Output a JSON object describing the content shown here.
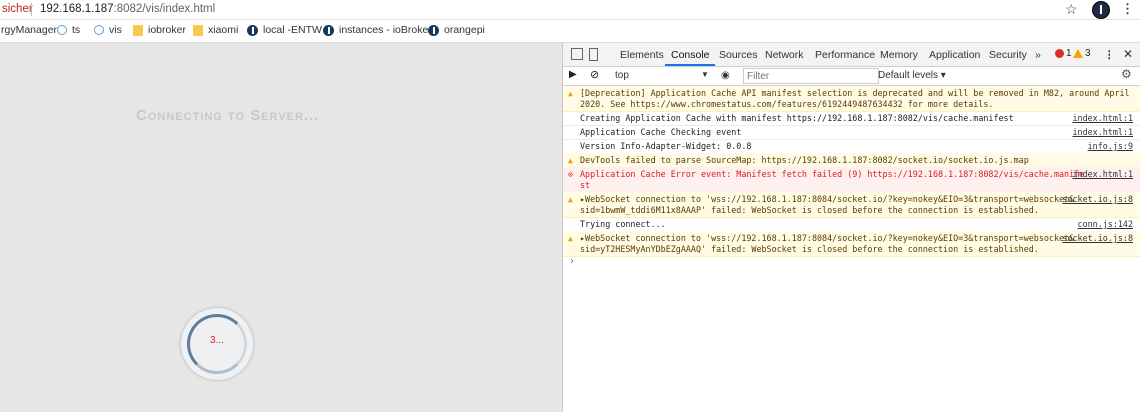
{
  "address_bar": {
    "security_text": "sicher",
    "url_host": "192.168.1.187",
    "url_rest": ":8082/vis/index.html"
  },
  "bookmarks": [
    {
      "label": "rgyManager",
      "icon": "none"
    },
    {
      "label": "ts",
      "icon": "cloud-icon"
    },
    {
      "label": "vis",
      "icon": "cloud-icon"
    },
    {
      "label": "iobroker",
      "icon": "folder-icon"
    },
    {
      "label": "xiaomi",
      "icon": "folder-icon"
    },
    {
      "label": "local -ENTW",
      "icon": "iobroker-icon"
    },
    {
      "label": "instances - ioBroker",
      "icon": "iobroker-icon"
    },
    {
      "label": "orangepi",
      "icon": "iobroker-icon"
    }
  ],
  "page": {
    "connecting_text": "Connecting to Server...",
    "countdown": "3..."
  },
  "devtools": {
    "tabs": [
      "Elements",
      "Console",
      "Sources",
      "Network",
      "Performance",
      "Memory",
      "Application",
      "Security"
    ],
    "active_tab": "Console",
    "more": "»",
    "error_count": "1",
    "warning_count": "3",
    "context": "top",
    "filter_placeholder": "Filter",
    "levels": "Default levels ▾",
    "messages": [
      {
        "level": "warn",
        "text": "[Deprecation] Application Cache API manifest selection is deprecated and will be removed in M82, around April\n2020. See https://www.chromestatus.com/features/6192449487634432 for more details.",
        "source": "",
        "lines": 2
      },
      {
        "level": "info",
        "text": "Creating Application Cache with manifest https://192.168.1.187:8082/vis/cache.manifest",
        "source": "index.html:1",
        "lines": 1
      },
      {
        "level": "info",
        "text": "Application Cache Checking event",
        "source": "index.html:1",
        "lines": 1
      },
      {
        "level": "info",
        "text": "Version Info-Adapter-Widget: 0.0.8",
        "source": "info.js:9",
        "lines": 1
      },
      {
        "level": "warn",
        "text": "DevTools failed to parse SourceMap: https://192.168.1.187:8082/socket.io/socket.io.js.map",
        "source": "",
        "lines": 1
      },
      {
        "level": "err",
        "text": "Application Cache Error event: Manifest fetch failed (9) https://192.168.1.187:8082/vis/cache.manife\nst",
        "source": "index.html:1",
        "lines": 2
      },
      {
        "level": "warn",
        "text": "▸WebSocket connection to 'wss://192.168.1.187:8084/socket.io/?key=nokey&EIO=3&transport=websocket&\nsid=1bwmW_tddi6M11x8AAAP' failed: WebSocket is closed before the connection is established.",
        "source": "socket.io.js:8",
        "lines": 2
      },
      {
        "level": "info",
        "text": "Trying connect...",
        "source": "conn.js:142",
        "lines": 1
      },
      {
        "level": "warn",
        "text": "▸WebSocket connection to 'wss://192.168.1.187:8084/socket.io/?key=nokey&EIO=3&transport=websocket&\nsid=yT2HESMyAnYDbEZgAAAQ' failed: WebSocket is closed before the connection is established.",
        "source": "socket.io.js:8",
        "lines": 2
      }
    ],
    "prompt": "›"
  }
}
